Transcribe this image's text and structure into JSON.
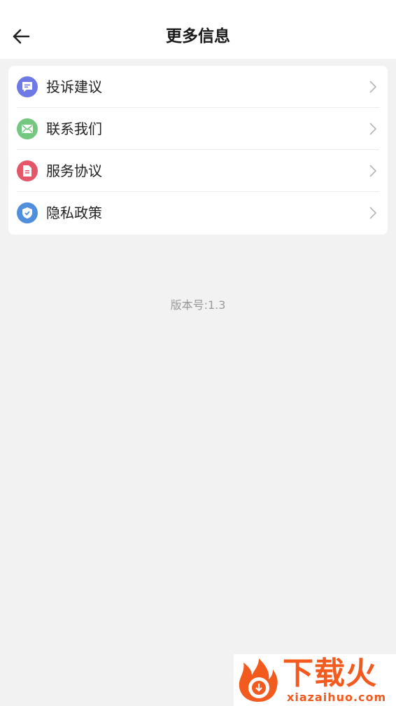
{
  "header": {
    "title": "更多信息",
    "back_icon": "arrow-left-icon"
  },
  "menu": [
    {
      "label": "投诉建议",
      "icon": "message-icon",
      "color": "#6e79e6"
    },
    {
      "label": "联系我们",
      "icon": "mail-icon",
      "color": "#74c77e"
    },
    {
      "label": "服务协议",
      "icon": "document-icon",
      "color": "#e5566a"
    },
    {
      "label": "隐私政策",
      "icon": "shield-icon",
      "color": "#4f8fdc"
    }
  ],
  "version_text": "版本号:1.3",
  "watermark": {
    "name": "下载火",
    "url": "xiazaihuo.com",
    "color": "#f25a1e"
  }
}
